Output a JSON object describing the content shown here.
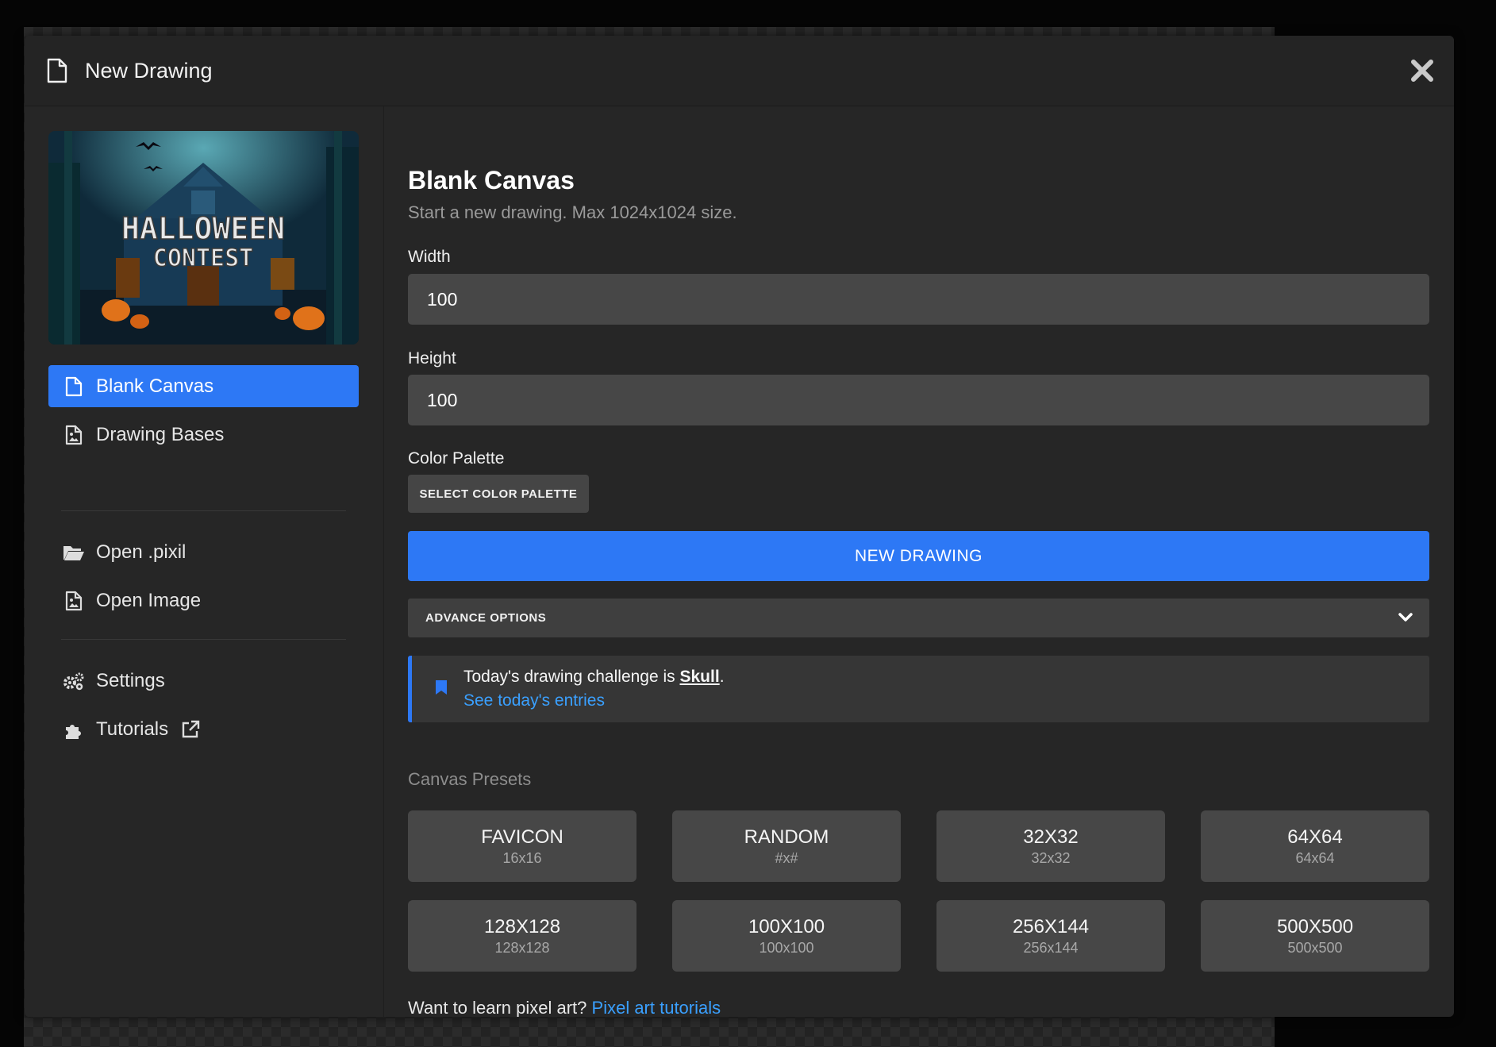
{
  "dialog": {
    "title": "New Drawing",
    "close_icon": "close-icon"
  },
  "banner": {
    "line1": "HALLOWEEN",
    "line2": "CONTEST"
  },
  "sidebar": {
    "items": [
      {
        "label": "Blank Canvas",
        "icon": "file-icon",
        "active": true
      },
      {
        "label": "Drawing Bases",
        "icon": "file-image-icon",
        "active": false
      },
      {
        "label": "Open .pixil",
        "icon": "folder-open-icon",
        "active": false
      },
      {
        "label": "Open Image",
        "icon": "image-file-icon",
        "active": false
      },
      {
        "label": "Settings",
        "icon": "gears-icon",
        "active": false
      },
      {
        "label": "Tutorials",
        "icon": "puzzle-icon",
        "active": false,
        "external_icon": "external-link-icon"
      }
    ]
  },
  "main": {
    "heading": "Blank Canvas",
    "subheading": "Start a new drawing. Max 1024x1024 size.",
    "width": {
      "label": "Width",
      "value": "100"
    },
    "height": {
      "label": "Height",
      "value": "100"
    },
    "palette": {
      "label": "Color Palette",
      "button": "SELECT COLOR PALETTE"
    },
    "new_drawing_button": "NEW DRAWING",
    "advance_options": "ADVANCE OPTIONS",
    "challenge": {
      "prefix": "Today's drawing challenge is ",
      "subject": "Skull",
      "suffix": ".",
      "link": "See today's entries"
    },
    "presets_title": "Canvas Presets",
    "presets": [
      {
        "name": "FAVICON",
        "size": "16x16"
      },
      {
        "name": "RANDOM",
        "size": "#x#"
      },
      {
        "name": "32X32",
        "size": "32x32"
      },
      {
        "name": "64X64",
        "size": "64x64"
      },
      {
        "name": "128X128",
        "size": "128x128"
      },
      {
        "name": "100X100",
        "size": "100x100"
      },
      {
        "name": "256X144",
        "size": "256x144"
      },
      {
        "name": "500X500",
        "size": "500x500"
      }
    ],
    "learn": {
      "text": "Want to learn pixel art? ",
      "link": "Pixel art tutorials"
    }
  },
  "colors": {
    "accent": "#2d78f5",
    "link": "#3aa0ff",
    "panel": "#262626",
    "input": "#474747"
  }
}
